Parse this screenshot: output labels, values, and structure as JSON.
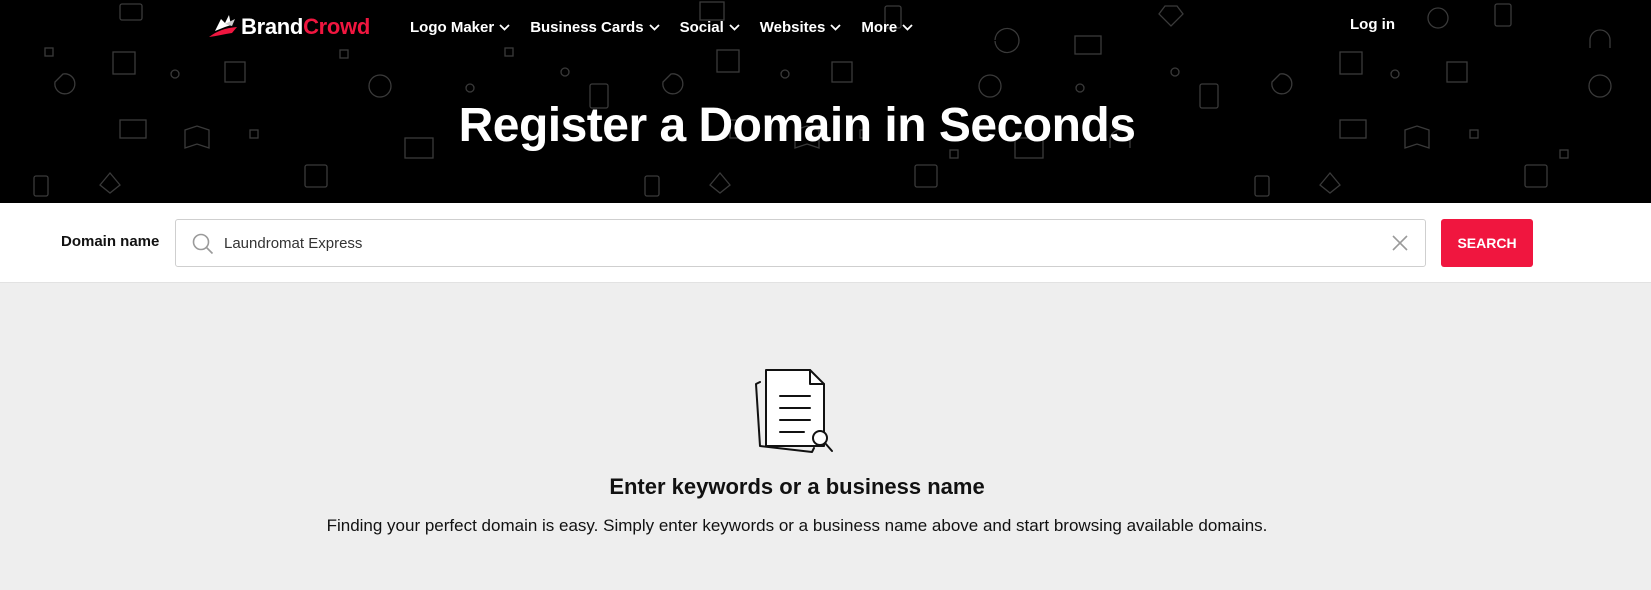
{
  "brand": {
    "part1": "Brand",
    "part2": "Crowd",
    "accent": "#f0163f"
  },
  "nav": {
    "items": [
      {
        "label": "Logo Maker"
      },
      {
        "label": "Business Cards"
      },
      {
        "label": "Social"
      },
      {
        "label": "Websites"
      },
      {
        "label": "More"
      }
    ],
    "login": "Log in"
  },
  "hero": {
    "title": "Register a Domain in Seconds"
  },
  "search": {
    "label": "Domain name",
    "value": "Laundromat Express",
    "button": "SEARCH"
  },
  "empty_state": {
    "icon": "document-search-icon",
    "title": "Enter keywords or a business name",
    "text": "Finding your perfect domain is easy. Simply enter keywords or a business name above and start browsing available domains."
  }
}
